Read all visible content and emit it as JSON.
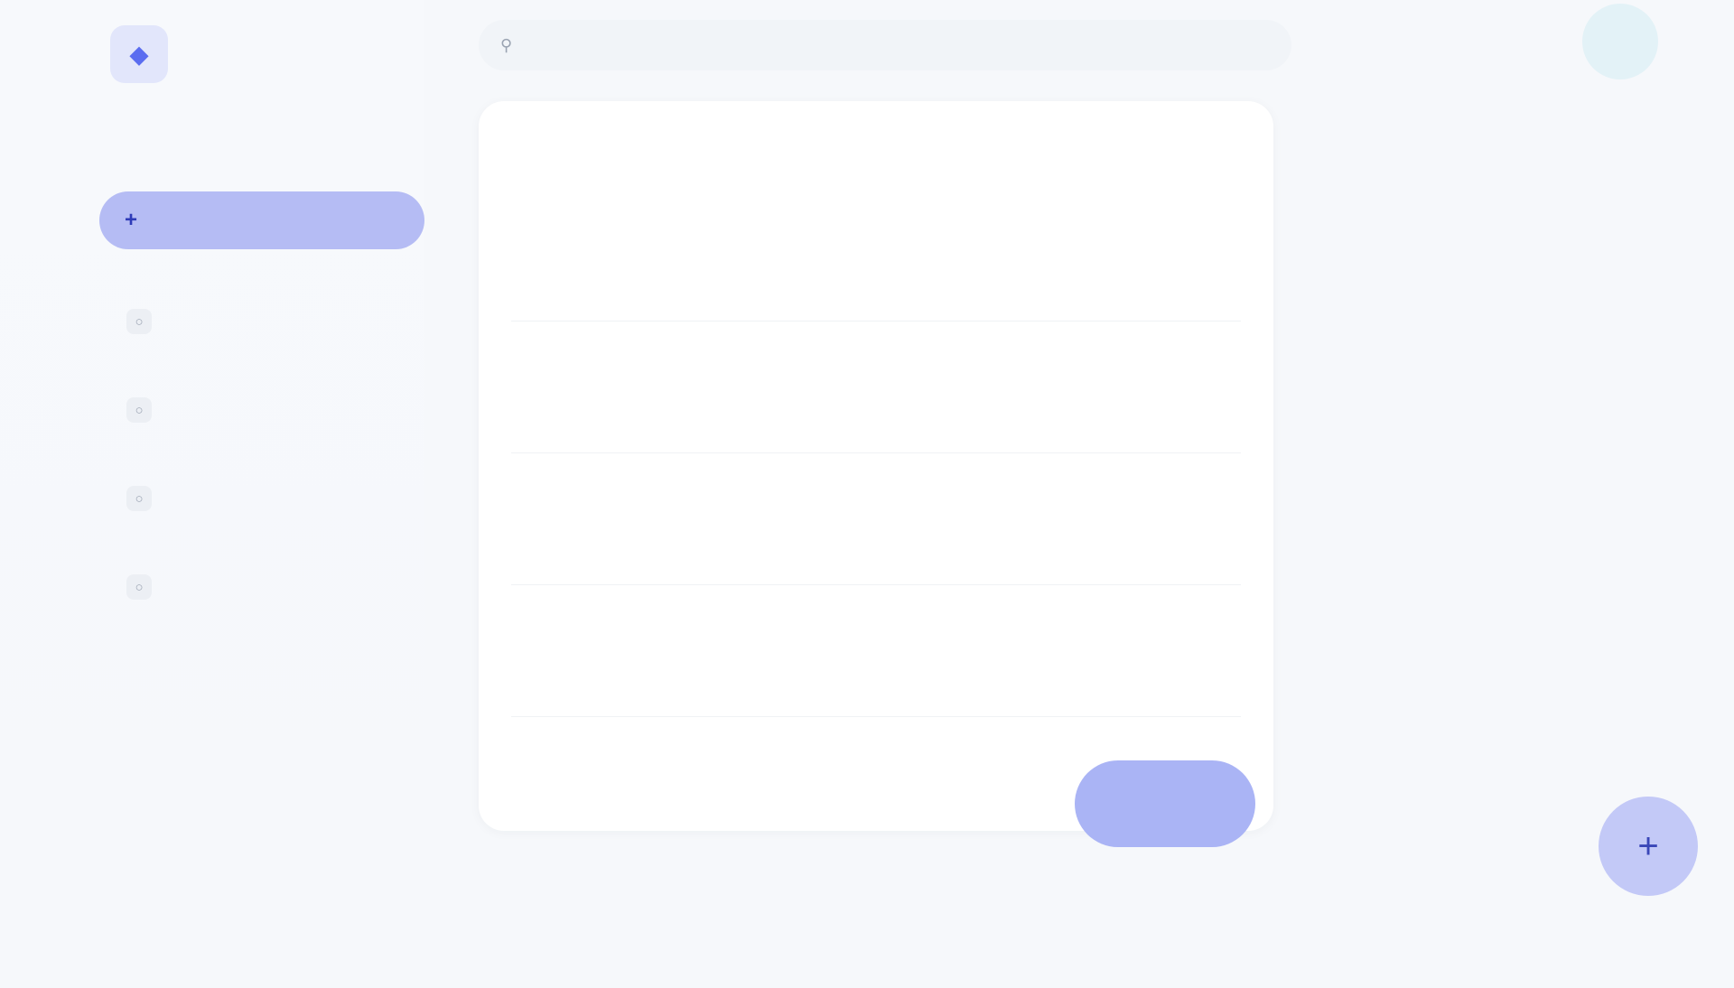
{
  "app": {
    "logo_glyph": "◆"
  },
  "sidebar": {
    "new_button_label": "",
    "items": [
      {
        "label": ""
      },
      {
        "label": ""
      },
      {
        "label": ""
      },
      {
        "label": ""
      }
    ]
  },
  "search": {
    "placeholder": ""
  },
  "user": {
    "initials": ""
  },
  "main": {
    "title": "",
    "rows": [
      {
        "title": "",
        "subtitle": "",
        "meta": ""
      },
      {
        "title": "",
        "subtitle": "",
        "meta": ""
      },
      {
        "title": "",
        "subtitle": "",
        "meta": ""
      },
      {
        "title": "",
        "subtitle": "",
        "meta": ""
      }
    ],
    "primary_button_label": ""
  },
  "footer": {
    "text": ""
  },
  "panel": {
    "title": "",
    "text": ""
  },
  "fab": {
    "icon": "+"
  },
  "colors": {
    "accent": "#b5bcf4",
    "primary_button": "#aab4f5",
    "fab": "#c3c9f7",
    "background": "#f6f8fb"
  }
}
